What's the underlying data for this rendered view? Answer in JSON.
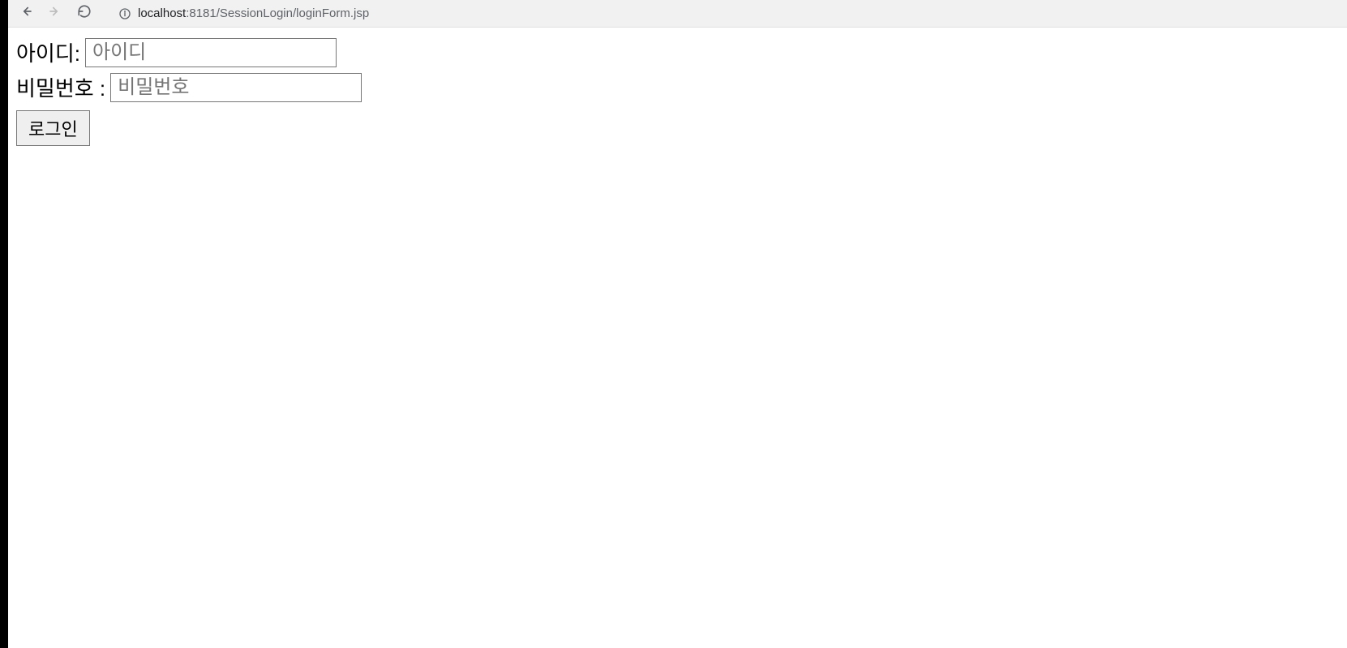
{
  "browser": {
    "url_host": "localhost",
    "url_path": ":8181/SessionLogin/loginForm.jsp"
  },
  "form": {
    "id_label": "아이디: ",
    "id_placeholder": "아이디",
    "id_value": "",
    "password_label": "비밀번호 : ",
    "password_placeholder": "비밀번호",
    "password_value": "",
    "login_button_label": "로그인"
  }
}
